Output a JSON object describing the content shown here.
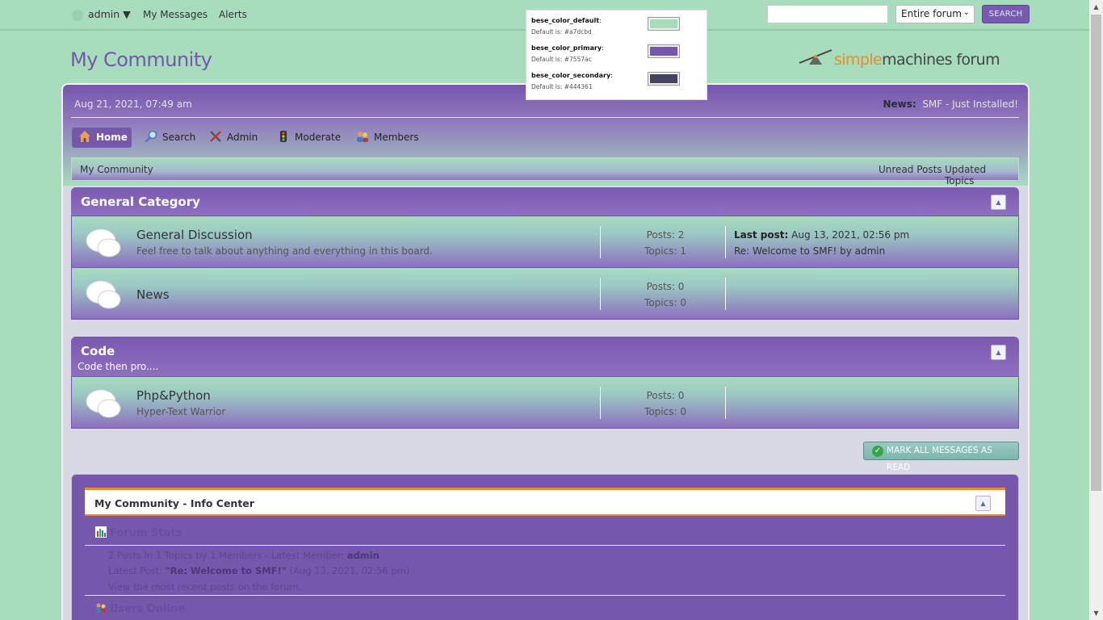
{
  "topbar": {
    "user_label": "admin ▼",
    "my_messages": "My Messages",
    "alerts": "Alerts",
    "search_placeholder": "",
    "search_scope": "Entire forum",
    "search_button": "SEARCH"
  },
  "color_popup": {
    "rows": [
      {
        "name": "bese_color_default",
        "default": "Default is: #a7dcbd",
        "color": "#a7dcbd"
      },
      {
        "name": "bese_color_primary",
        "default": "Default is: #7557ac",
        "color": "#7557ac"
      },
      {
        "name": "bese_color_secondary",
        "default": "Default is: #444361",
        "color": "#444361"
      }
    ]
  },
  "header": {
    "forum_title": "My Community",
    "logo_simple": "simple",
    "logo_machines": "machines",
    "logo_forum": " forum"
  },
  "upper": {
    "date": "Aug 21, 2021, 07:49 am",
    "news_label": "News:",
    "news_text": "SMF - Just Installed!"
  },
  "nav": {
    "home": "Home",
    "search": "Search",
    "admin": "Admin",
    "moderate": "Moderate",
    "members": "Members"
  },
  "linktree": {
    "breadcrumb": "My Community",
    "unread": "Unread Posts",
    "updated": "Updated Topics"
  },
  "categories": [
    {
      "name": "General Category",
      "boards": [
        {
          "title": "General Discussion",
          "desc": "Feel free to talk about anything and everything in this board.",
          "posts": "Posts: 2",
          "topics": "Topics: 1",
          "last_label": "Last post:",
          "last_date": "Aug 13, 2021, 02:56 pm",
          "last_topic": "Re: Welcome to SMF! by admin"
        },
        {
          "title": "News",
          "desc": "",
          "posts": "Posts: 0",
          "topics": "Topics: 0"
        }
      ]
    },
    {
      "name": "Code",
      "desc": "Code then pro....",
      "boards": [
        {
          "title": "Php&Python",
          "desc": "Hyper-Text Warrior",
          "posts": "Posts: 0",
          "topics": "Topics: 0"
        }
      ]
    }
  ],
  "mark_read": "MARK ALL MESSAGES AS READ",
  "info_center": {
    "title": "My Community - Info Center",
    "forum_stats": "Forum Stats",
    "stats_line_prefix": "2 Posts in 1 Topics by 1 Members - Latest Member:",
    "stats_latest_member": "admin",
    "latest_post_prefix": "Latest Post:",
    "latest_post_title": "\"Re: Welcome to SMF!\"",
    "latest_post_date": "(Aug 13, 2021, 02:56 pm)",
    "recent_link": "View the most recent posts on the forum.",
    "users_online": "Users Online"
  },
  "colors": {
    "default": "#a7dcbd",
    "primary": "#7557ac",
    "secondary": "#444361",
    "accent_orange": "#f08a24"
  }
}
